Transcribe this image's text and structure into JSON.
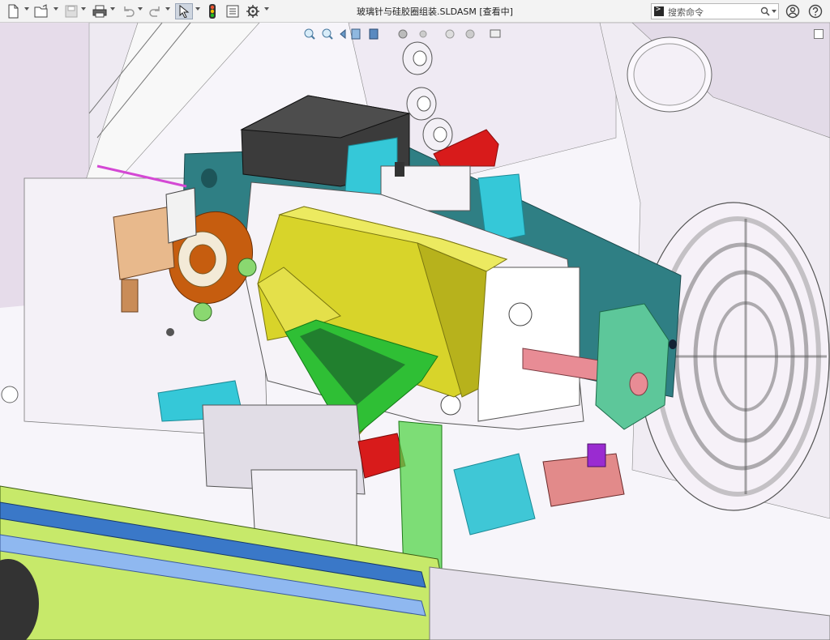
{
  "window": {
    "title": "玻璃针与硅胶圈组装.SLDASM [查看中]"
  },
  "toolbar": {
    "buttons": [
      {
        "name": "new-document",
        "icon": "new-document-icon"
      },
      {
        "name": "open-file",
        "icon": "open-folder-icon"
      },
      {
        "name": "save",
        "icon": "save-icon"
      },
      {
        "name": "print",
        "icon": "print-icon"
      },
      {
        "name": "undo",
        "icon": "undo-icon"
      },
      {
        "name": "redo",
        "icon": "redo-icon"
      },
      {
        "name": "select",
        "icon": "select-arrow-icon"
      },
      {
        "name": "rebuild",
        "icon": "traffic-light-icon"
      },
      {
        "name": "file-properties",
        "icon": "file-properties-icon"
      },
      {
        "name": "options",
        "icon": "gear-icon"
      }
    ]
  },
  "search": {
    "placeholder": "搜索命令"
  },
  "help": {
    "icons": [
      "user-icon",
      "help-icon"
    ]
  },
  "heads_up_toolbar": {
    "icons": [
      "zoom-to-fit-icon",
      "zoom-area-icon",
      "previous-view-icon",
      "section-view-icon",
      "view-orientation-icon",
      "display-style-icon",
      "hide-show-icon",
      "edit-appearance-icon",
      "apply-scene-icon",
      "view-settings-icon"
    ]
  },
  "colors": {
    "teal_plate": "#2f7f84",
    "cyan_parts": "#35c8d8",
    "yellow_body": "#d8d42a",
    "green_mesh": "#2fbf35",
    "red_block": "#d81b1b",
    "lavender_frame": "#ece7f2",
    "rail_blue": "#3a78c8",
    "rail_lime": "#c7e96a"
  }
}
